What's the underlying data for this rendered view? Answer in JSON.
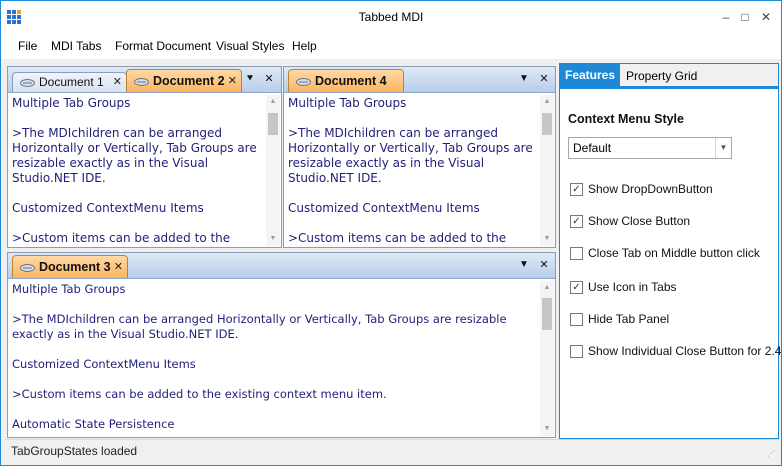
{
  "window": {
    "title": "Tabbed MDI",
    "minimize_glyph": "–",
    "maximize_glyph": "□",
    "close_glyph": "✕"
  },
  "menu": [
    "File",
    "MDI Tabs",
    "Format Document",
    "Visual Styles",
    "Help"
  ],
  "groups": {
    "top_left": {
      "tabs": [
        {
          "label": "Document 1",
          "active": false
        },
        {
          "label": "Document 2",
          "active": true
        }
      ],
      "text": [
        "Multiple Tab Groups",
        ">The MDIchildren can be arranged Horizontally or Vertically, Tab Groups are resizable exactly as in the Visual Studio.NET IDE.",
        "Customized ContextMenu Items",
        ">Custom items can be added to the existing"
      ]
    },
    "top_right": {
      "tabs": [
        {
          "label": "Document 4",
          "active": true
        }
      ],
      "text": [
        "Multiple Tab Groups",
        ">The MDIchildren can be arranged Horizontally or Vertically, Tab Groups are resizable exactly as in the Visual Studio.NET IDE.",
        "Customized ContextMenu Items",
        ">Custom items can be added to the existing"
      ]
    },
    "bottom": {
      "tabs": [
        {
          "label": "Document 3",
          "active": true
        }
      ],
      "text": [
        "Multiple Tab Groups",
        ">The MDIchildren can be arranged Horizontally or Vertically, Tab Groups are resizable exactly as in the Visual Studio.NET IDE.",
        "Customized ContextMenu Items",
        ">Custom items can be added to the existing context menu item.",
        "Automatic State Persistence"
      ]
    }
  },
  "glyphs": {
    "tab_close": "✕",
    "dropdown": "▼",
    "dropdown_list": "⯆",
    "scroll_up": "▲",
    "scroll_down": "▼"
  },
  "side_panel": {
    "tabs": [
      "Features",
      "Property Grid"
    ],
    "active_tab": "Features",
    "section_title": "Context Menu Style",
    "combo_value": "Default",
    "options": [
      {
        "label": "Show DropDownButton",
        "checked": true
      },
      {
        "label": "Show Close Button",
        "checked": true
      },
      {
        "label": "Close Tab on Middle button click",
        "checked": false
      },
      {
        "label": "Use Icon in Tabs",
        "checked": true
      },
      {
        "label": "Hide Tab Panel",
        "checked": false
      },
      {
        "label": "Show Individual Close Button for 2.4",
        "checked": false
      }
    ]
  },
  "status": {
    "text": "TabGroupStates loaded"
  },
  "colors": {
    "accent": "#1e88d6",
    "tab_active": "#fbb45f",
    "doc_text": "#1f1f7a"
  }
}
